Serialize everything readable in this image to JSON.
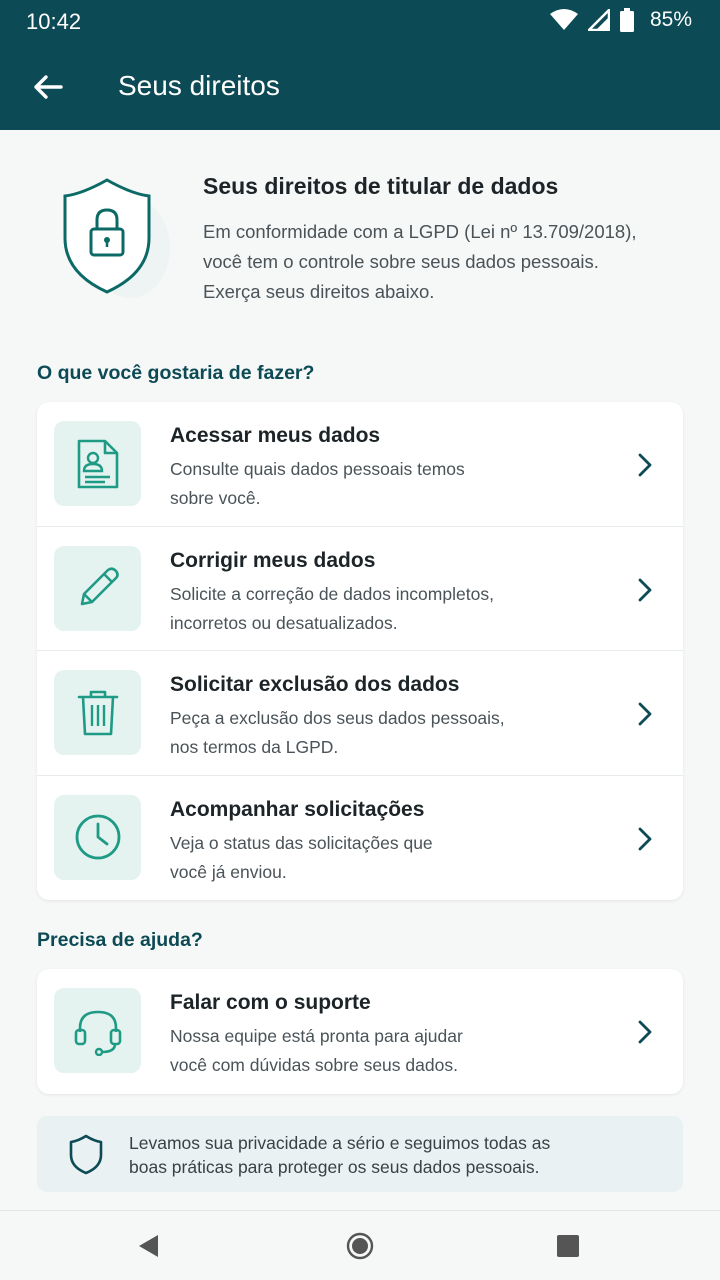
{
  "status_bar": {
    "time": "10:42",
    "battery": "85%"
  },
  "app_bar": {
    "title": "Seus direitos"
  },
  "intro": {
    "title": "Seus direitos de titular de dados",
    "lines": [
      "Em conformidade com a LGPD (Lei nº 13.709/2018),",
      "você tem o controle sobre seus dados pessoais.",
      "Exerça seus direitos abaixo."
    ]
  },
  "actions_section": {
    "label": "O que você gostaria de fazer?",
    "items": [
      {
        "icon": "document-person-icon",
        "title": "Acessar meus dados",
        "desc": [
          "Consulte quais dados pessoais temos",
          "sobre você."
        ]
      },
      {
        "icon": "pencil-icon",
        "title": "Corrigir meus dados",
        "desc": [
          "Solicite a correção de dados incompletos,",
          "incorretos ou desatualizados."
        ]
      },
      {
        "icon": "trash-icon",
        "title": "Solicitar exclusão dos dados",
        "desc": [
          "Peça a exclusão dos seus dados pessoais,",
          "nos termos da LGPD."
        ]
      },
      {
        "icon": "clock-icon",
        "title": "Acompanhar solicitações",
        "desc": [
          "Veja o status das solicitações que",
          "você já enviou."
        ]
      }
    ]
  },
  "help_section": {
    "label": "Precisa de ajuda?",
    "item": {
      "icon": "headset-icon",
      "title": "Falar com o suporte",
      "desc": [
        "Nossa equipe está pronta para ajudar",
        "você com dúvidas sobre seus dados."
      ]
    }
  },
  "note": {
    "lines": [
      "Levamos sua privacidade a sério e seguimos todas as",
      "boas práticas para proteger os seus dados pessoais."
    ]
  },
  "colors": {
    "primary": "#0c4a55",
    "accent": "#1f9a85",
    "icon_bg": "#e4f3f0"
  }
}
